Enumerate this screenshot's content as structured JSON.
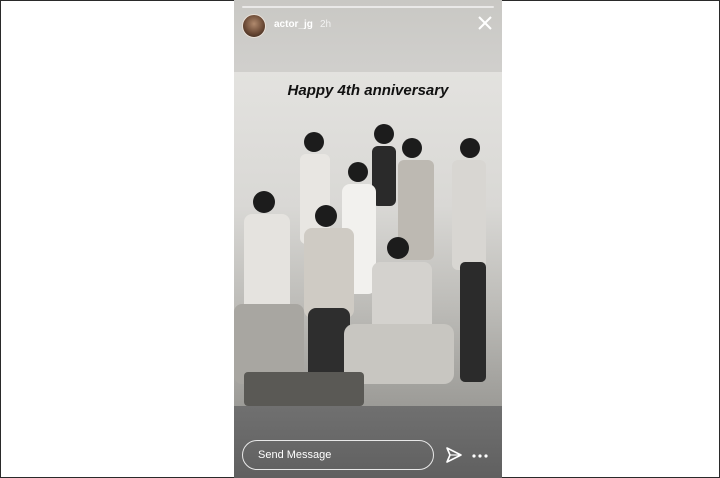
{
  "header": {
    "username": "actor_jg",
    "time_ago": "2h",
    "close_icon": "close-icon",
    "avatar_icon": "avatar"
  },
  "story": {
    "caption": "Happy 4th anniversary"
  },
  "footer": {
    "send_placeholder": "Send Message",
    "send_icon": "paper-plane-icon",
    "more_icon": "more-options-icon"
  },
  "colors": {
    "text_light": "#ffffff",
    "caption_text": "#111111"
  }
}
